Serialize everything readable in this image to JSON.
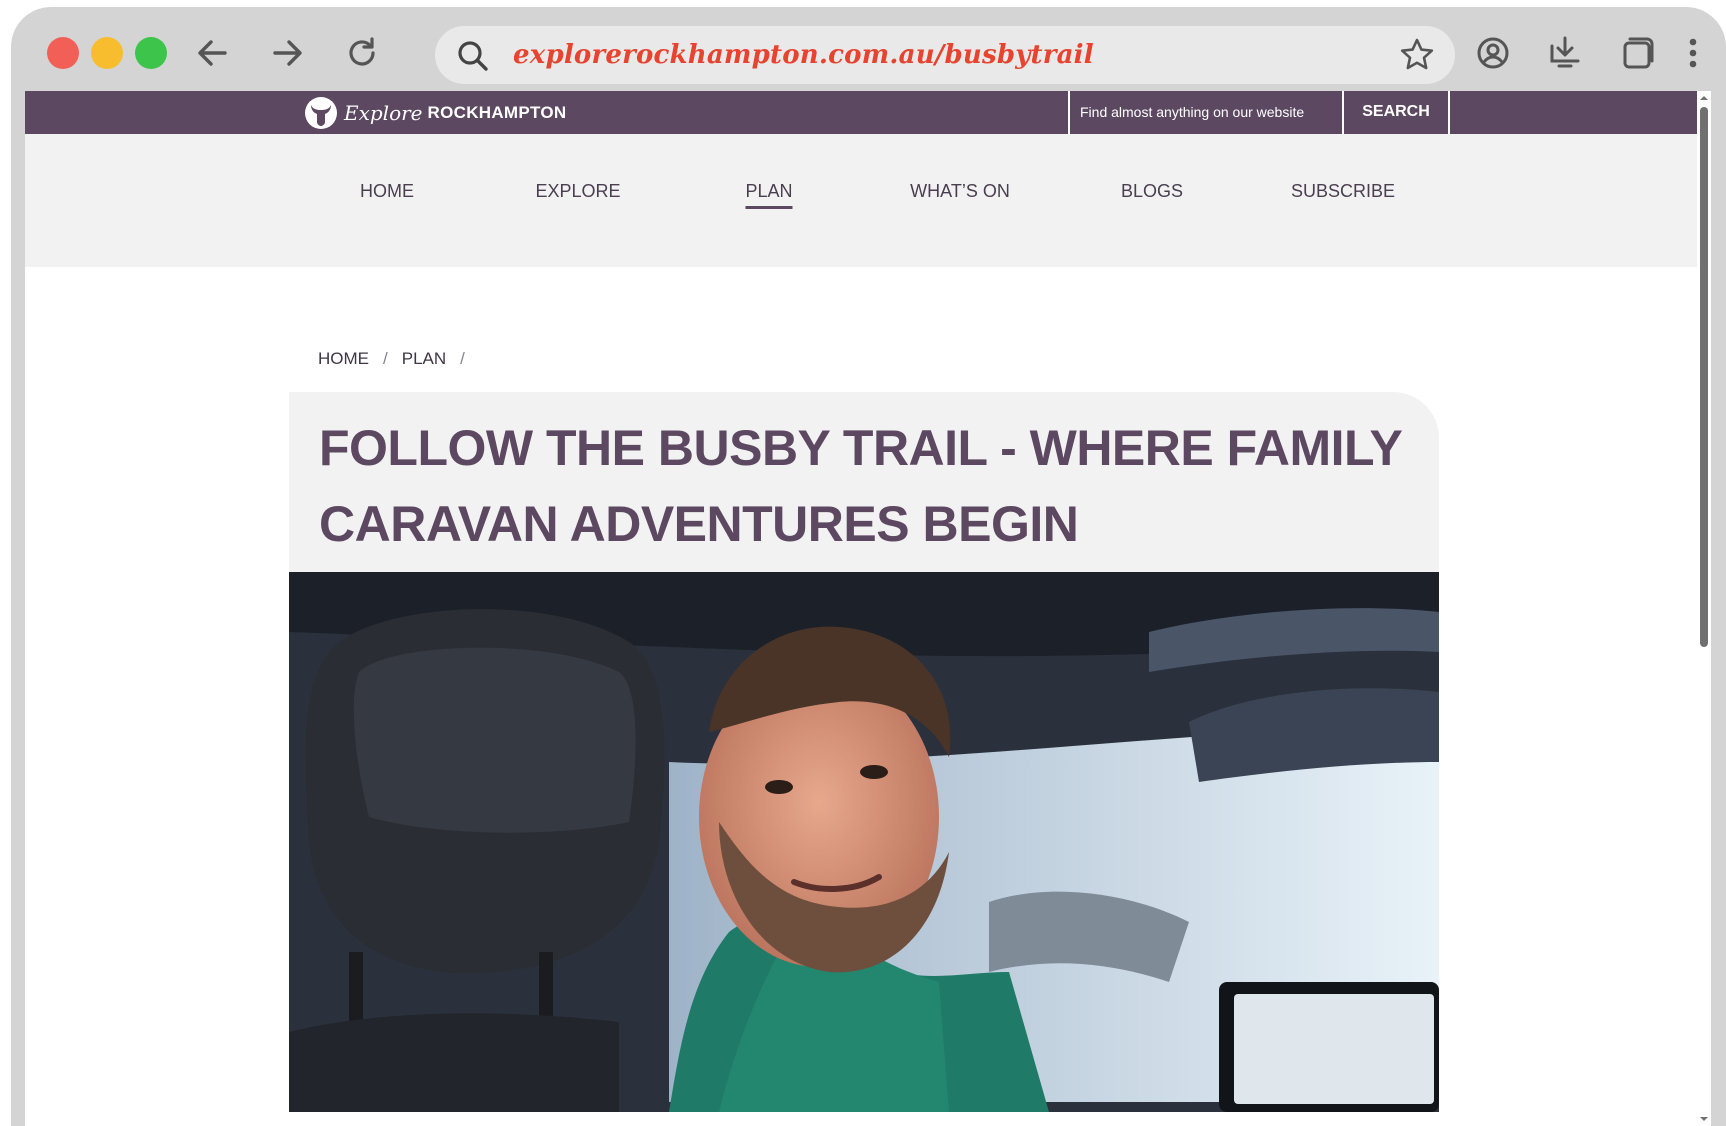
{
  "browser": {
    "url": "explorerockhampton.com.au/busbytrail"
  },
  "site": {
    "logo_script": "Explore",
    "logo_city": "ROCKHAMPTON",
    "search_placeholder": "Find almost anything on our website",
    "search_button": "SEARCH"
  },
  "nav": {
    "items": [
      {
        "label": "HOME"
      },
      {
        "label": "EXPLORE"
      },
      {
        "label": "PLAN"
      },
      {
        "label": "WHAT’S ON"
      },
      {
        "label": "BLOGS"
      },
      {
        "label": "SUBSCRIBE"
      }
    ],
    "active": "PLAN"
  },
  "breadcrumb": {
    "items": [
      {
        "label": "HOME"
      },
      {
        "label": "PLAN"
      }
    ],
    "separator": "/"
  },
  "article": {
    "title": "FOLLOW THE BUSBY TRAIL - WHERE FAMILY CARAVAN ADVENTURES BEGIN"
  },
  "colors": {
    "brand_purple": "#5d4861",
    "url_red": "#e8432f",
    "nav_bg": "#f2f2f2"
  }
}
